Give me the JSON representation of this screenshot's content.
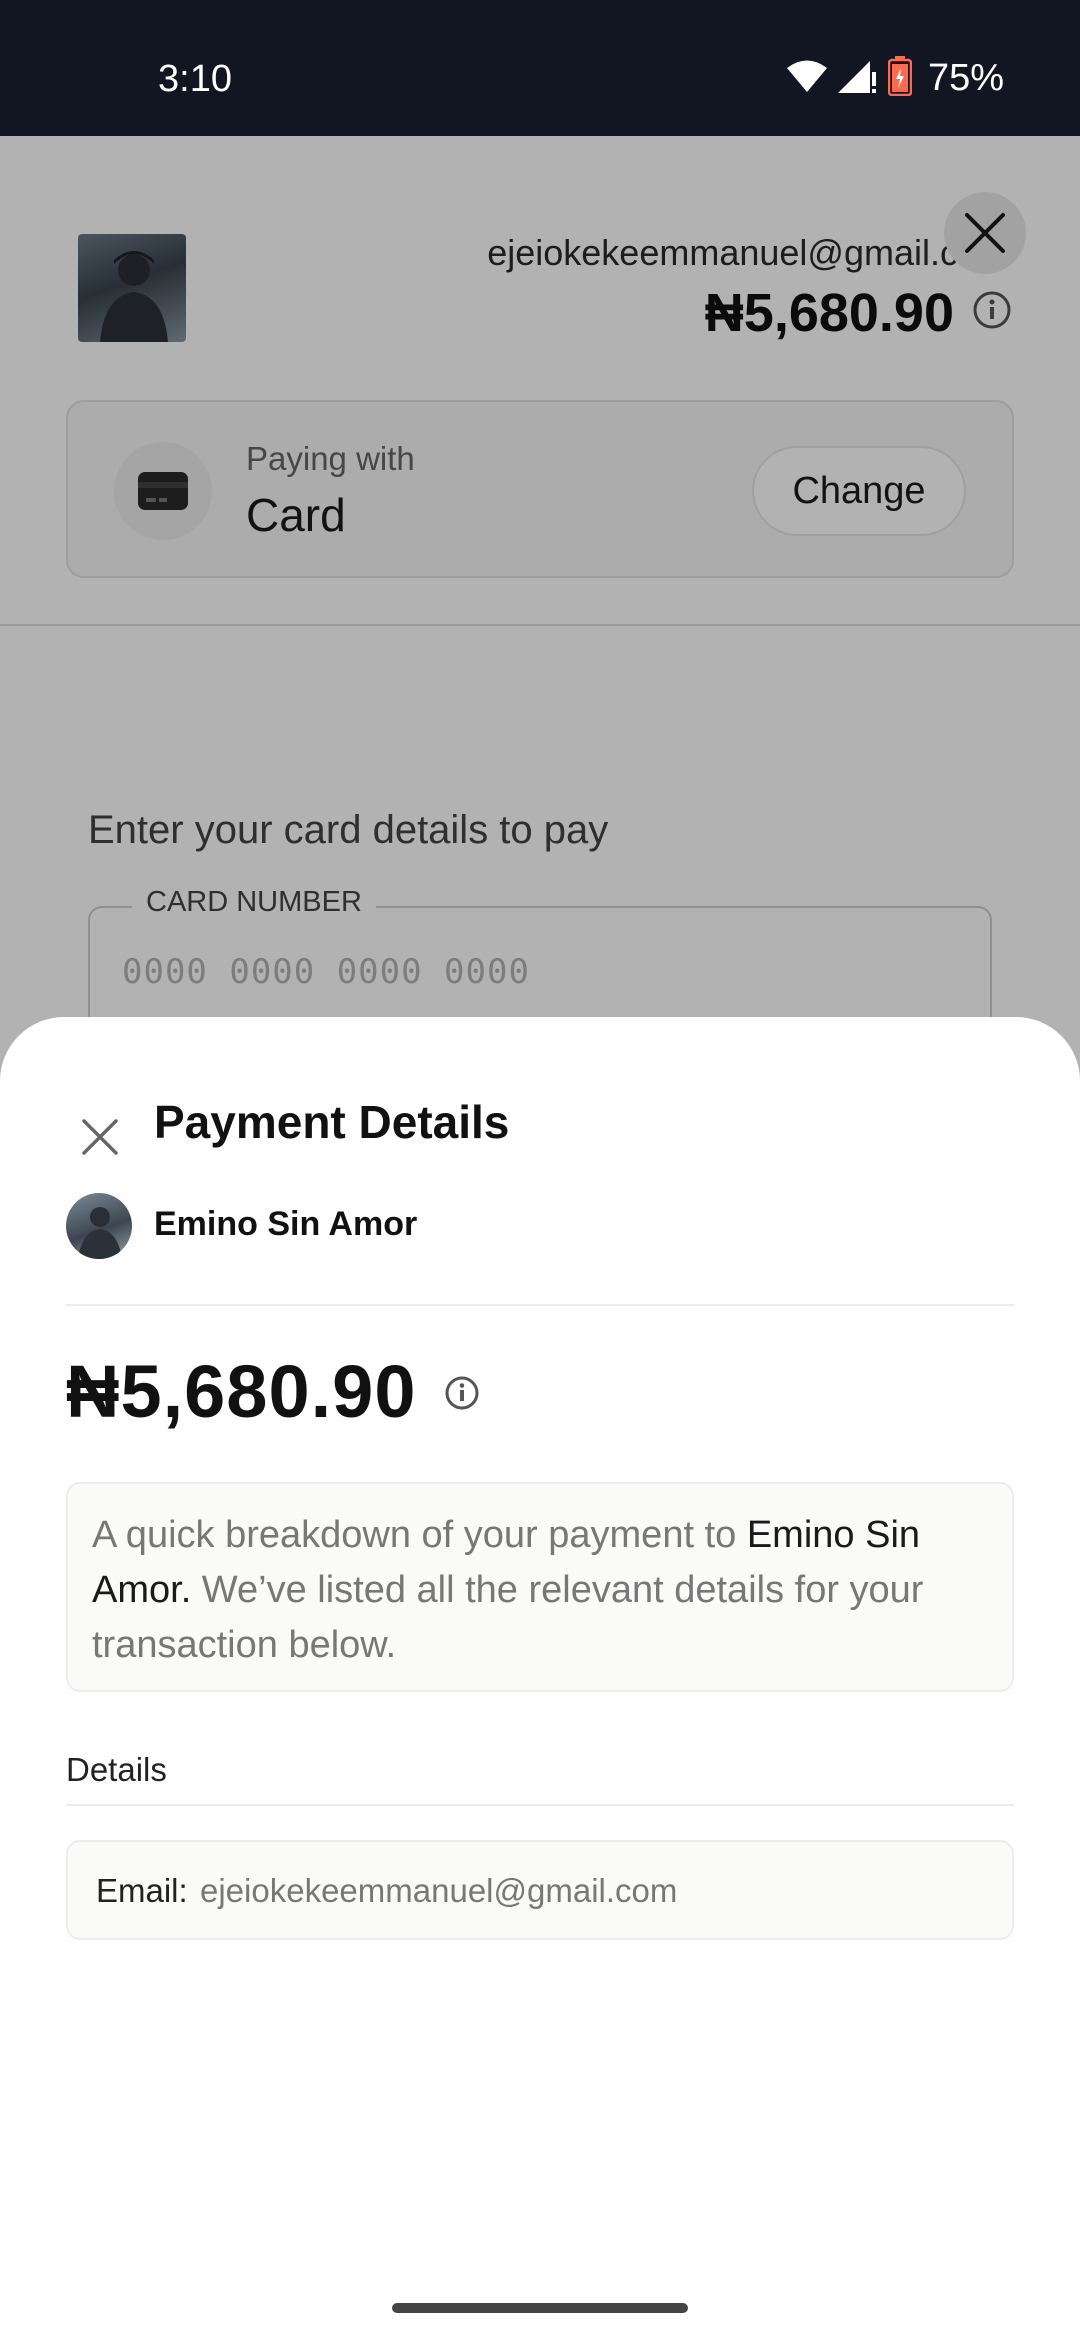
{
  "status_bar": {
    "time": "3:10",
    "battery_percent": "75%",
    "icons": [
      "wifi-icon",
      "cell-signal-icon",
      "battery-icon"
    ]
  },
  "background_page": {
    "email": "ejeiokekeemmanuel@gmail.com",
    "amount": "₦5,680.90",
    "paying_with_label": "Paying with",
    "payment_method": "Card",
    "change_label": "Change",
    "enter_card_prompt": "Enter your card details to pay",
    "card_number_label": "CARD NUMBER",
    "card_number_placeholder": "0000 0000 0000 0000"
  },
  "sheet": {
    "title": "Payment Details",
    "recipient_name": "Emino Sin Amor",
    "amount": "₦5,680.90",
    "breakdown": {
      "prefix": "A quick breakdown of your payment to ",
      "recipient": "Emino Sin Amor.",
      "suffix": " We’ve listed all the relevant details for your transaction below."
    },
    "details_label": "Details",
    "email_label": "Email:",
    "email_value": "ejeiokekeemmanuel@gmail.com"
  },
  "colors": {
    "status_bar_bg": "#121522",
    "overlay": "rgba(0,0,0,0.30)",
    "sheet_bg": "#ffffff",
    "text_primary": "#111111",
    "text_muted": "#777777"
  }
}
